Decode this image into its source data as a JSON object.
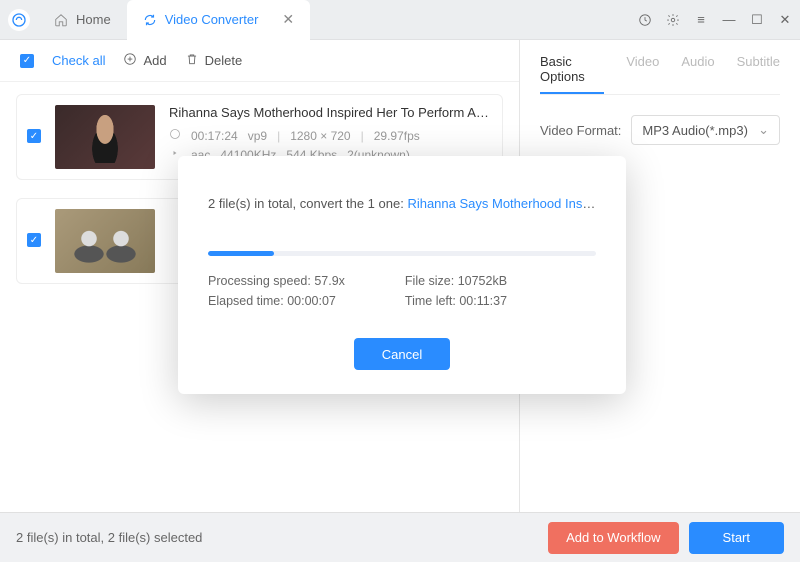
{
  "tabs": {
    "home": "Home",
    "converter": "Video Converter"
  },
  "toolbar": {
    "check_all": "Check all",
    "add": "Add",
    "delete": "Delete"
  },
  "items": [
    {
      "title": "Rihanna Says Motherhood Inspired Her To Perform At Supe…",
      "duration": "00:17:24",
      "vcodec": "vp9",
      "resolution": "1280 × 720",
      "fps": "29.97fps",
      "acodec": "aac",
      "srate": "44100KHz",
      "bitrate": "544 Kbps",
      "channels": "2(unknown)"
    },
    {
      "title": ""
    }
  ],
  "opts": {
    "tabs": {
      "basic": "Basic Options",
      "video": "Video",
      "audio": "Audio",
      "subtitle": "Subtitle"
    },
    "format_label": "Video Format:",
    "format_value": "MP3 Audio(*.mp3)"
  },
  "modal": {
    "msg_pre": "2 file(s) in total, convert the 1 one: ",
    "msg_file": "Rihanna Says Motherhood Inspired Her …",
    "speed_label": "Processing speed: ",
    "speed_val": "57.9x",
    "elapsed_label": "Elapsed time: ",
    "elapsed_val": "00:00:07",
    "size_label": "File size: ",
    "size_val": "10752kB",
    "left_label": "Time left: ",
    "left_val": "00:11:37",
    "cancel": "Cancel",
    "progress_pct": 17
  },
  "footer": {
    "status": "2 file(s) in total, 2 file(s) selected",
    "workflow": "Add to Workflow",
    "start": "Start"
  }
}
